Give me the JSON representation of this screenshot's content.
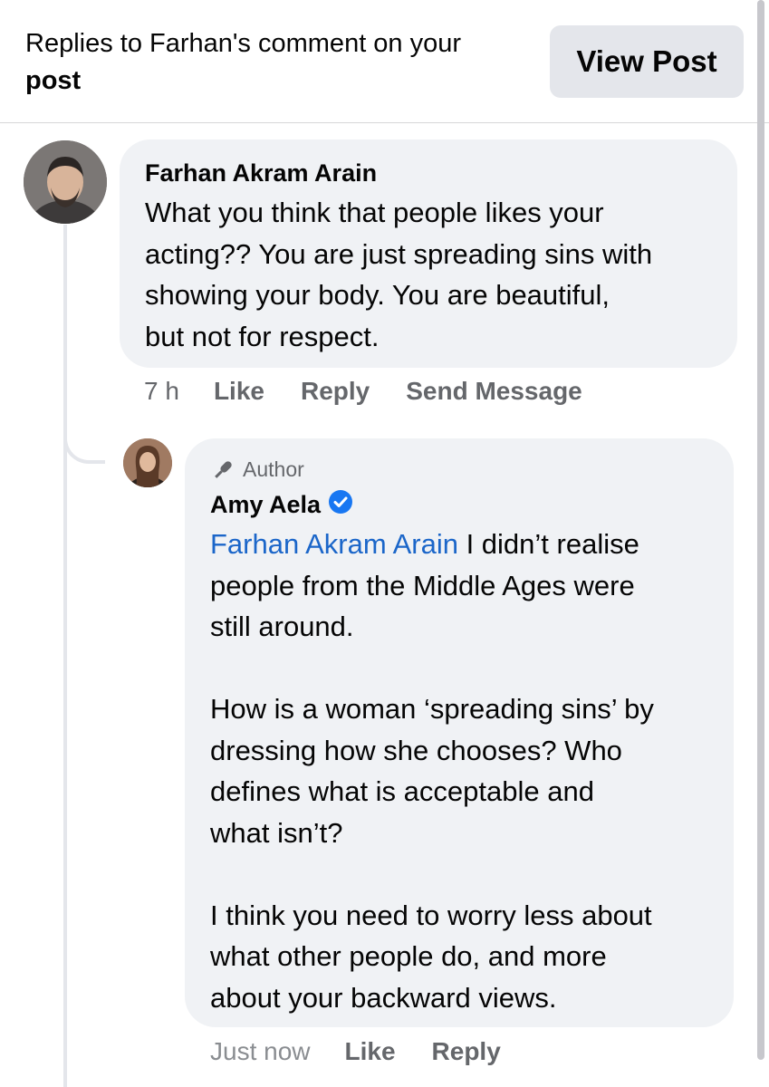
{
  "header": {
    "title_line1": "Replies to Farhan's comment on your",
    "title_line2": "post",
    "view_post_label": "View Post"
  },
  "comments": {
    "farhan": {
      "author": "Farhan Akram Arain",
      "text": "What you think that people likes your\nacting?? You are just spreading sins with\nshowing your body. You are beautiful,\nbut not for respect.",
      "time": "7 h",
      "like_label": "Like",
      "reply_label": "Reply",
      "send_message_label": "Send Message"
    },
    "amy": {
      "badge": "Author",
      "author": "Amy Aela",
      "mention": "Farhan Akram Arain",
      "text": " I didn’t realise\npeople from the Middle Ages were\nstill around.\n\nHow is a woman ‘spreading sins’ by\ndressing how she chooses? Who\ndefines what is acceptable and\nwhat isn’t?\n\nI think you need to worry less about\nwhat other people do, and more\nabout your backward views.",
      "time": "Just now",
      "like_label": "Like",
      "reply_label": "Reply"
    }
  },
  "colors": {
    "bubble": "#f0f2f5",
    "mention": "#1b66c9",
    "verified": "#1877f2",
    "meta": "#65676b",
    "button_bg": "#e4e6eb"
  },
  "icons": {
    "author_badge": "microphone-icon",
    "verified": "verified-badge-icon"
  }
}
